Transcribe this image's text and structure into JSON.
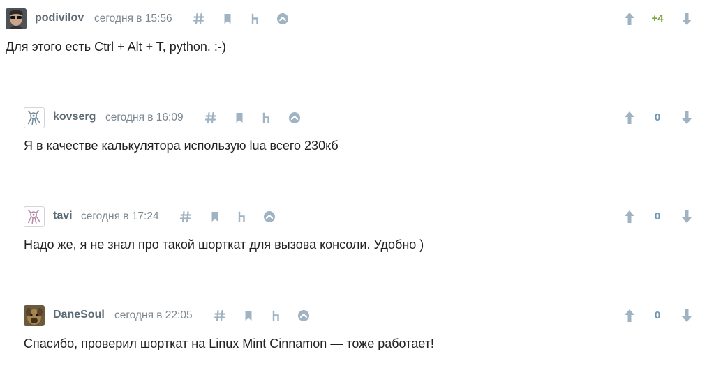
{
  "comments": [
    {
      "author": "podivilov",
      "time": "сегодня в 15:56",
      "text": "Для этого есть Ctrl + Alt + T, python. :-)",
      "score": "+4",
      "score_color": "#7da33b",
      "avatar": "photo-face-icon"
    },
    {
      "author": "kovserg",
      "time": "сегодня в 16:09",
      "text": "Я в качестве калькулятора использую lua всего 230кб",
      "score": "0",
      "score_color": "#6a95b5",
      "avatar": "default-avatar-icon"
    },
    {
      "author": "tavi",
      "time": "сегодня в 17:24",
      "text": "Надо же, я не знал про такой шорткат для вызова консоли. Удобно )",
      "score": "0",
      "score_color": "#6a95b5",
      "avatar": "default-avatar-icon"
    },
    {
      "author": "DaneSoul",
      "time": "сегодня в 22:05",
      "text": "Спасибо, проверил шорткат на Linux Mint Cinnamon — тоже работает!",
      "score": "0",
      "score_color": "#6a95b5",
      "avatar": "photo-animal-icon"
    }
  ],
  "colors": {
    "icon": "#9fb3c3",
    "author": "#5c6a74",
    "time": "#7b8790"
  }
}
